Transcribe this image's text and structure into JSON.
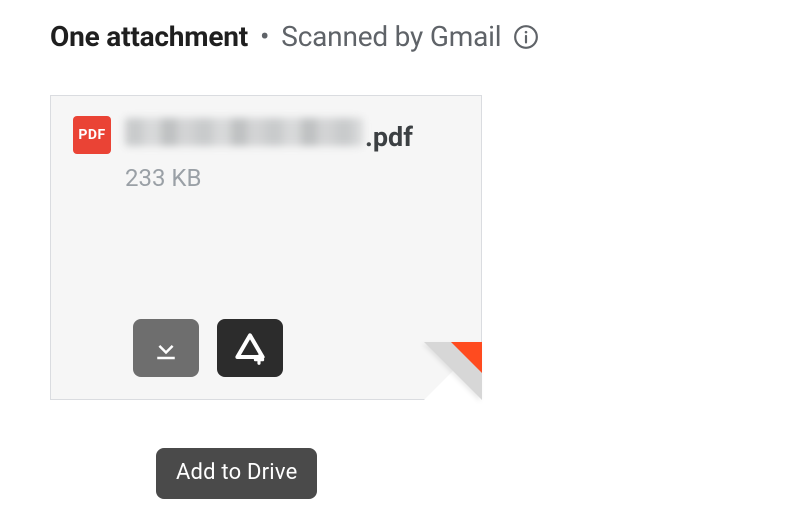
{
  "header": {
    "title": "One attachment",
    "separator": "•",
    "scanned": "Scanned by Gmail"
  },
  "attachment": {
    "badge": "PDF",
    "extension": ".pdf",
    "size": "233 KB"
  },
  "tooltip": {
    "addToDrive": "Add to Drive"
  },
  "colors": {
    "pdf_red": "#ea4335",
    "curl_accent": "#ff4b1f"
  }
}
